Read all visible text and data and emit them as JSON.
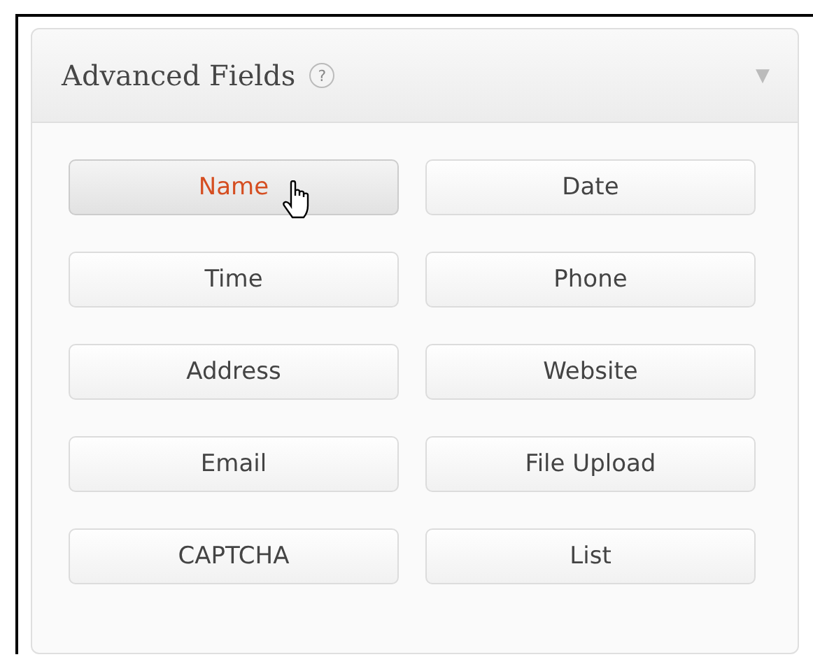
{
  "panel": {
    "title": "Advanced Fields",
    "help": "?",
    "collapse": "▼"
  },
  "buttons": [
    {
      "label": "Name",
      "hovered": true
    },
    {
      "label": "Date",
      "hovered": false
    },
    {
      "label": "Time",
      "hovered": false
    },
    {
      "label": "Phone",
      "hovered": false
    },
    {
      "label": "Address",
      "hovered": false
    },
    {
      "label": "Website",
      "hovered": false
    },
    {
      "label": "Email",
      "hovered": false
    },
    {
      "label": "File Upload",
      "hovered": false
    },
    {
      "label": "CAPTCHA",
      "hovered": false
    },
    {
      "label": "List",
      "hovered": false
    }
  ]
}
